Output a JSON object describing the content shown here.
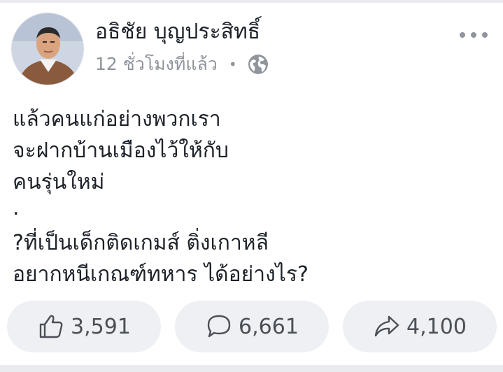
{
  "post": {
    "author": "อธิชัย บุญประสิทธิ์",
    "timestamp": "12 ชั่วโมงที่แล้ว",
    "separator": "•",
    "privacy_icon": "globe-icon",
    "menu_icon": "more-options-icon",
    "lines": [
      "แล้วคนแก่อย่างพวกเรา",
      "จะฝากบ้านเมืองไว้ให้กับ",
      "คนรุ่นใหม่",
      ".",
      "?ที่เป็นเด็กติดเกมส์ ติ่งเกาหลี",
      "อยากหนีเกณฑ์ทหาร ได้อย่างไร?"
    ]
  },
  "actions": {
    "like_count": "3,591",
    "comment_count": "6,661",
    "share_count": "4,100"
  },
  "colors": {
    "text": "#1d2129",
    "secondary": "#90949c",
    "pill_bg": "#eef0f3",
    "icon": "#4b4f56"
  }
}
